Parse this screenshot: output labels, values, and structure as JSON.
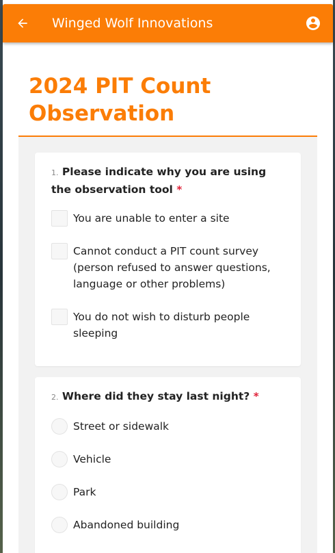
{
  "appbar": {
    "title": "Winged Wolf Innovations",
    "back_icon": "arrow-left-icon",
    "account_icon": "account-circle-icon",
    "color": "#fb7d06"
  },
  "page": {
    "title_line1": "2024 PIT Count",
    "title_line2": "Observation",
    "accent": "#fb7d06"
  },
  "questions": [
    {
      "number": "1.",
      "text": "Please indicate why you are using the observation tool",
      "required_mark": "*",
      "type": "checkbox",
      "options": [
        "You are unable to enter a site",
        "Cannot conduct a PIT count survey (person refused to answer questions, language or other problems)",
        "You do not wish to disturb people sleeping"
      ]
    },
    {
      "number": "2.",
      "text": "Where did they stay last night?",
      "required_mark": "*",
      "type": "radio",
      "options": [
        "Street or sidewalk",
        "Vehicle",
        "Park",
        "Abandoned building"
      ]
    }
  ]
}
